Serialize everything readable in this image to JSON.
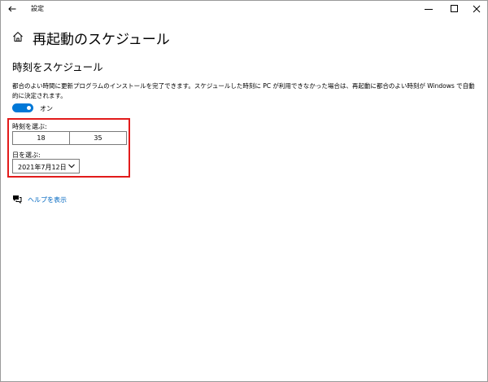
{
  "window": {
    "title": "設定",
    "back_icon": "back-arrow-icon",
    "minimize_icon": "minimize-icon",
    "maximize_icon": "maximize-icon",
    "close_icon": "close-icon"
  },
  "header": {
    "home_icon": "home-icon",
    "title": "再起動のスケジュール"
  },
  "schedule": {
    "section_title": "時刻をスケジュール",
    "description": "都合のよい時間に更新プログラムのインストールを完了できます。スケジュールした時刻に PC が利用できなかった場合は、再起動に都合のよい時刻が Windows で自動的に決定されます。",
    "toggle_state": "on",
    "toggle_label": "オン",
    "time_label": "時刻を選ぶ:",
    "hour": "18",
    "minute": "35",
    "day_label": "日を選ぶ:",
    "date": "2021年7月12日"
  },
  "help": {
    "icon": "help-chat-icon",
    "link": "ヘルプを表示"
  },
  "colors": {
    "accent": "#0078d7",
    "link": "#0067c0",
    "highlight": "#e21b1b"
  }
}
